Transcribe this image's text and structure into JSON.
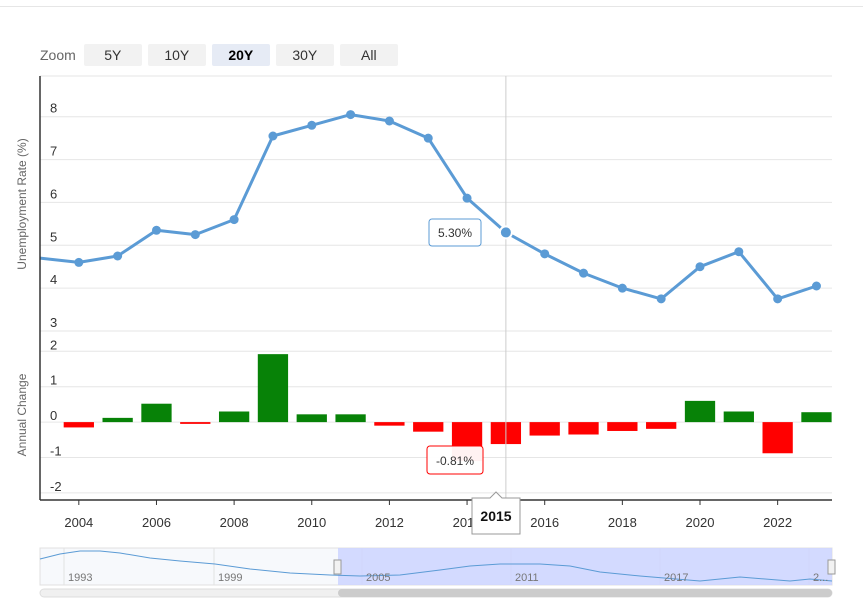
{
  "zoom": {
    "label": "Zoom",
    "buttons": [
      "5Y",
      "10Y",
      "20Y",
      "30Y",
      "All"
    ],
    "active": "20Y"
  },
  "chart_data": {
    "type": "line",
    "x": [
      2003,
      2004,
      2005,
      2006,
      2007,
      2008,
      2009,
      2010,
      2011,
      2012,
      2013,
      2014,
      2015,
      2016,
      2017,
      2018,
      2019,
      2020,
      2021,
      2022,
      2023
    ],
    "series": [
      {
        "name": "",
        "type": "line",
        "panel": "upper",
        "color": "#5b9bd5",
        "values": [
          4.7,
          4.6,
          4.75,
          5.35,
          5.25,
          5.6,
          7.55,
          7.8,
          8.05,
          7.9,
          7.5,
          6.1,
          5.3,
          4.8,
          4.35,
          4.0,
          3.75,
          4.5,
          4.85,
          3.75,
          4.05
        ]
      },
      {
        "name": "",
        "type": "bar",
        "panel": "lower",
        "positive_color": "#078207",
        "negative_color": "#ff0000",
        "values": [
          null,
          -0.15,
          0.12,
          0.52,
          -0.05,
          0.3,
          1.92,
          0.22,
          0.22,
          -0.1,
          -0.27,
          -1.1,
          -0.62,
          -0.38,
          -0.35,
          -0.25,
          -0.19,
          0.6,
          0.3,
          -0.88,
          0.28
        ]
      }
    ],
    "xlabel": "",
    "ylabel_upper": "Unemployment Rate (%)",
    "ylabel_lower": "Annual Change",
    "xticks": [
      2004,
      2006,
      2008,
      2010,
      2012,
      2014,
      2016,
      2018,
      2020,
      2022
    ],
    "yticks_upper": [
      3,
      4,
      5,
      6,
      7,
      8
    ],
    "yticks_lower": [
      -2,
      -1,
      0,
      1,
      2
    ],
    "xlim": [
      2003,
      2023.4
    ],
    "ylim_upper": [
      2.65,
      8.95
    ],
    "ylim_lower": [
      -2.2,
      2.15
    ],
    "grid": true,
    "hover": {
      "x_label": "2015",
      "upper_value": "5.30%",
      "lower_value": "-0.81%"
    },
    "navigator": {
      "labels": [
        "1993",
        "1999",
        "2005",
        "2011",
        "2017",
        "2..."
      ],
      "color": "#5b9bd5",
      "selection_fill": "#ccd5ff"
    }
  }
}
